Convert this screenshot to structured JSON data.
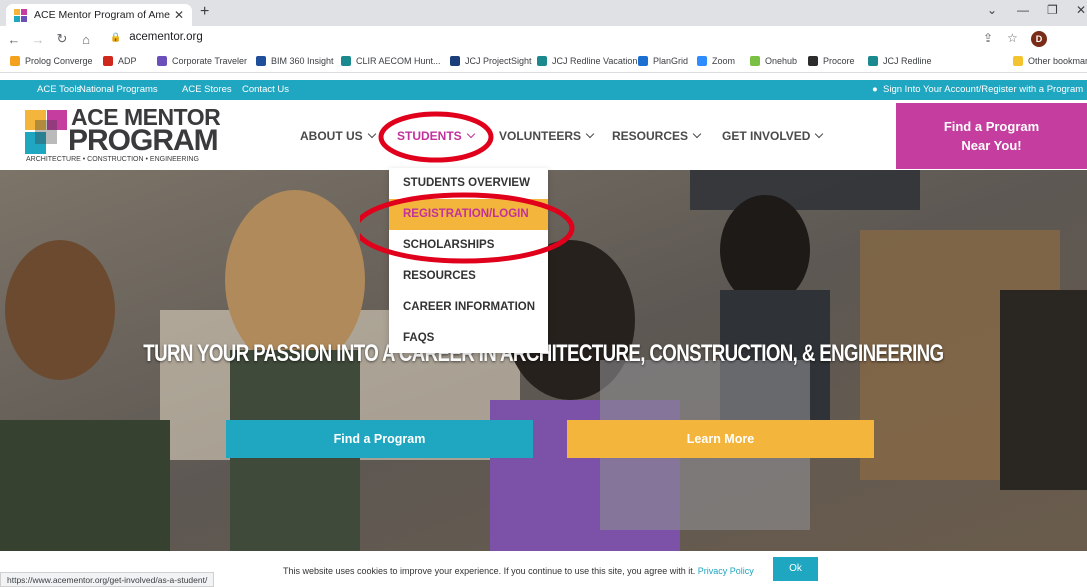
{
  "browser": {
    "tab_title": "ACE Mentor Program of America",
    "url": "acementor.org",
    "avatar_initial": "D",
    "bookmarks": [
      {
        "label": "Prolog Converge",
        "color": "#f4a11d"
      },
      {
        "label": "ADP",
        "color": "#d0271d"
      },
      {
        "label": "Corporate Traveler",
        "color": "#6b4fbb"
      },
      {
        "label": "BIM 360 Insight",
        "color": "#1f4e9a"
      },
      {
        "label": "CLIR AECOM Hunt...",
        "color": "#1b8a8f"
      },
      {
        "label": "JCJ ProjectSight",
        "color": "#1a3f7a"
      },
      {
        "label": "JCJ Redline Vacation",
        "color": "#1b8a8f"
      },
      {
        "label": "PlanGrid",
        "color": "#1b6fd1"
      },
      {
        "label": "Zoom",
        "color": "#2d8cff"
      },
      {
        "label": "Onehub",
        "color": "#7ac143"
      },
      {
        "label": "Procore",
        "color": "#2c2c2c"
      },
      {
        "label": "JCJ Redline",
        "color": "#1b8a8f"
      },
      {
        "label": "Other bookmarks",
        "color": "#f4c430"
      }
    ],
    "status_url": "https://www.acementor.org/get-involved/as-a-student/"
  },
  "site": {
    "top_links": [
      "ACE Tools",
      "National Programs",
      "ACE Stores",
      "Contact Us"
    ],
    "sign_in": "Sign Into Your Account/Register with a Program",
    "logo": {
      "line1": "ACE MENTOR",
      "line2": "PROGRAM",
      "tagline": "ARCHITECTURE • CONSTRUCTION • ENGINEERING"
    },
    "nav": [
      {
        "label": "ABOUT US"
      },
      {
        "label": "STUDENTS"
      },
      {
        "label": "VOLUNTEERS"
      },
      {
        "label": "RESOURCES"
      },
      {
        "label": "GET INVOLVED"
      }
    ],
    "find_program": {
      "line1": "Find a Program",
      "line2": "Near You!"
    },
    "dropdown": [
      "STUDENTS OVERVIEW",
      "REGISTRATION/LOGIN",
      "SCHOLARSHIPS",
      "RESOURCES",
      "CAREER INFORMATION",
      "FAQS"
    ],
    "hero_title": "TURN YOUR PASSION INTO A CAREER IN ARCHITECTURE, CONSTRUCTION, & ENGINEERING",
    "cta_find": "Find a Program",
    "cta_learn": "Learn More",
    "cookie_text": "This website uses cookies to improve your experience. If you continue to use this site, you agree with it.",
    "cookie_link": "Privacy Policy",
    "cookie_ok": "Ok"
  },
  "colors": {
    "brand_teal": "#1fa6c0",
    "brand_magenta": "#c43d9f",
    "brand_yellow": "#f3b53c",
    "annotation_red": "#e0001b"
  }
}
